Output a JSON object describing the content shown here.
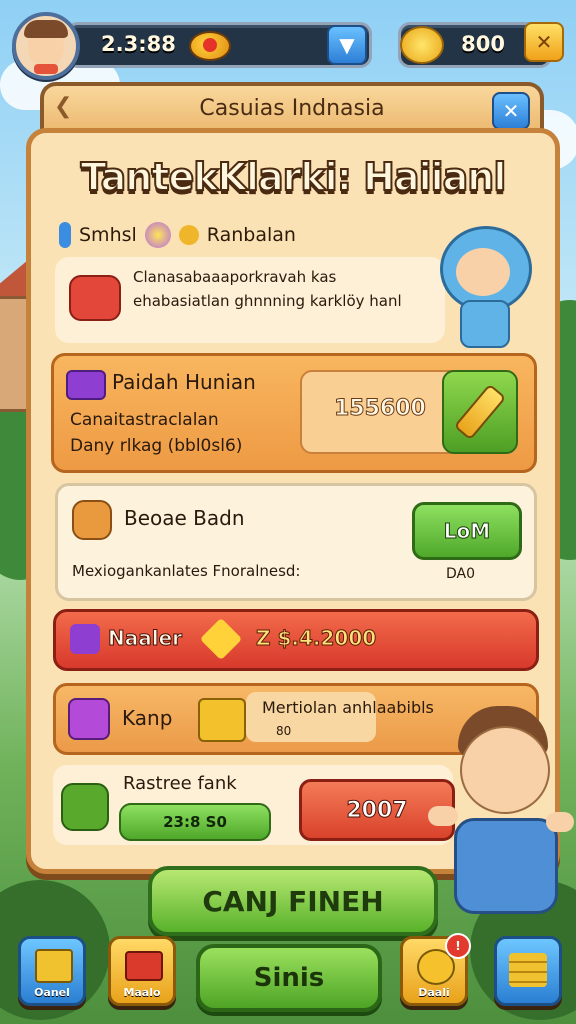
{
  "hud": {
    "player_value": "2.3:88",
    "coins": "800"
  },
  "panel": {
    "tab_title": "Casuias Indnasia",
    "headline": "TantekKlarki: Haiianl",
    "subrow": {
      "left_label": "Smhsl",
      "right_label": "Ranbalan"
    },
    "intro_text": "Clanasaba​aaporkravah kas ehabasiatlan ghnnning karklöy hanl"
  },
  "offer": {
    "title": "Paidah Hunian",
    "desc_line1": "Canaitastraclalan",
    "desc_line2": "Dany rlkag (bbl0sl6)",
    "price": "155600"
  },
  "bonus": {
    "title": "Beoae Badn",
    "button_label": "LoM",
    "desc": "Mexiogankanlates Fnoralnesd:",
    "side_value": "DA0"
  },
  "red_banner": {
    "label": "Naaler",
    "value": "Z $.4.2000"
  },
  "kanp_row": {
    "label": "Kanp",
    "text": "Mertiolan anhlaabibls",
    "small": "80"
  },
  "reward_row": {
    "title": "Rastree fank",
    "amount": "23:8 S0",
    "button_value": "2007"
  },
  "main_button": "CANJ FINEH",
  "bottom_nav": {
    "left1": "Oanel",
    "left2": "Maalo",
    "center": "Sinis",
    "right1": "Daali",
    "badge": "!"
  },
  "colors": {
    "accent_orange": "#f2a450",
    "accent_green": "#59b22a",
    "accent_red": "#e2473a"
  }
}
